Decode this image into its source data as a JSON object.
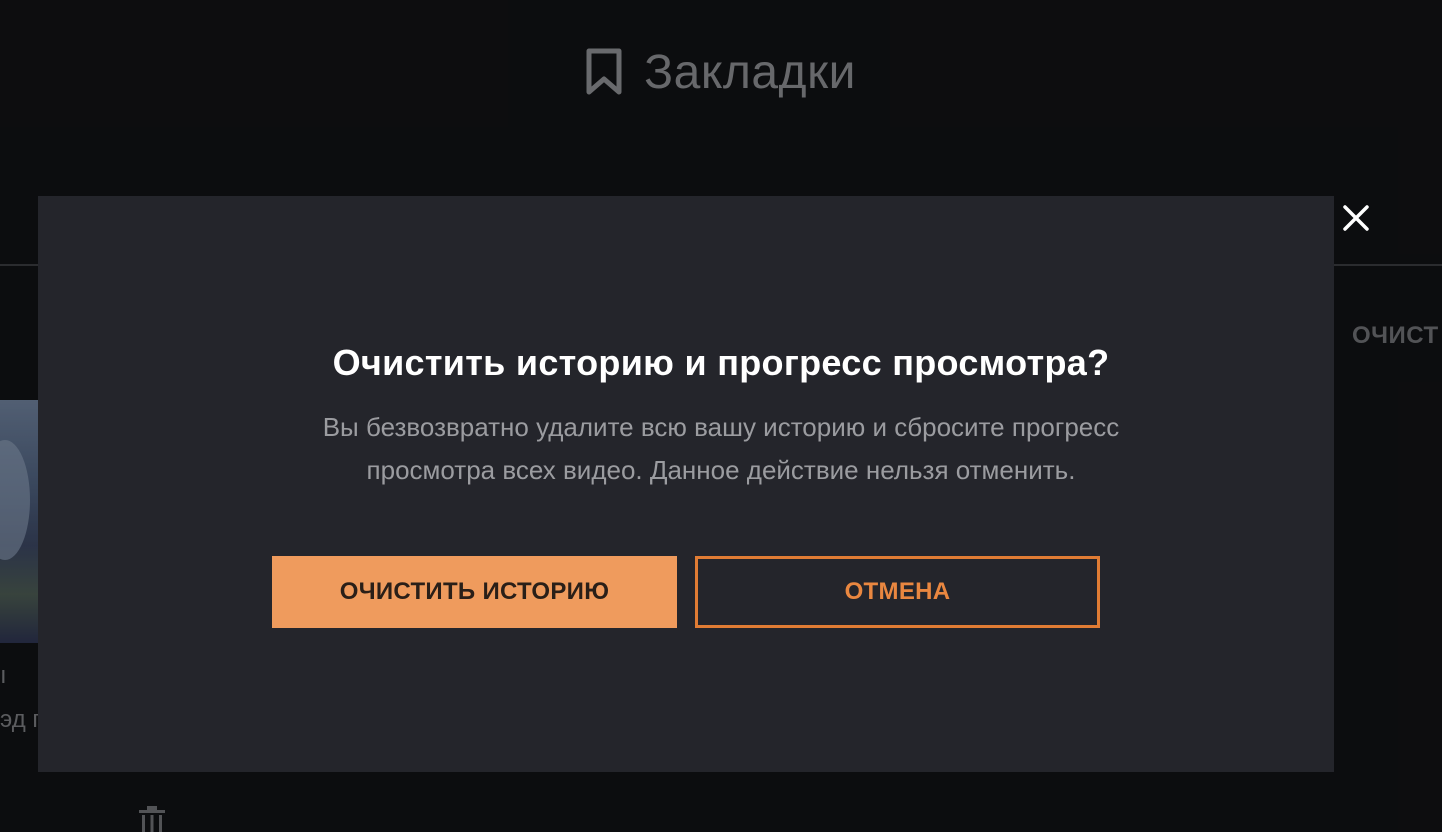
{
  "header": {
    "title": "Закладки",
    "icon": "bookmark-icon"
  },
  "background": {
    "clear_link": "ОЧИСТ",
    "thumb_text_1": "ı",
    "thumb_text_2": "эд г",
    "trash_icon": "trash-icon"
  },
  "modal": {
    "title": "Очистить историю и прогресс просмотра?",
    "description_line1": "Вы безвозвратно удалите всю вашу историю и сбросите прогресс",
    "description_line2": "просмотра всех видео. Данное действие нельзя отменить.",
    "confirm_label": "ОЧИСТИТЬ ИСТОРИЮ",
    "cancel_label": "ОТМЕНА",
    "close_icon": "close-icon"
  },
  "colors": {
    "accent": "#ef9b5d",
    "accent_border": "#e07c34",
    "modal_bg": "#24252b",
    "page_bg": "#111214"
  }
}
